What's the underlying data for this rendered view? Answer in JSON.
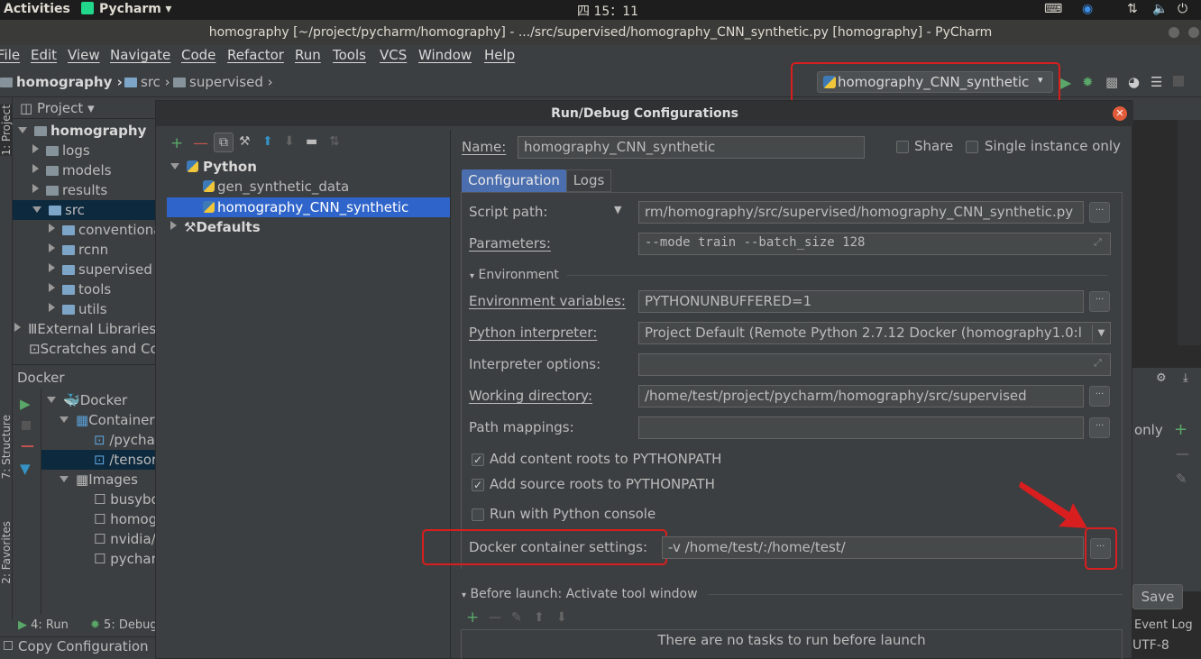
{
  "topbar": {
    "activities": "Activities",
    "app": "Pycharm",
    "clock": "四 15：11"
  },
  "window_title": "homography [~/project/pycharm/homography] - .../src/supervised/homography_CNN_synthetic.py [homography] - PyCharm",
  "menu": [
    "File",
    "Edit",
    "View",
    "Navigate",
    "Code",
    "Refactor",
    "Run",
    "Tools",
    "VCS",
    "Window",
    "Help"
  ],
  "breadcrumb": [
    "homography",
    "src",
    "supervised"
  ],
  "run_config_selector": "homography_CNN_synthetic",
  "project_panel": {
    "title": "Project",
    "items": [
      "homography",
      "logs",
      "models",
      "results",
      "src",
      "conventional",
      "rcnn",
      "supervised",
      "tools",
      "utils",
      "External Libraries",
      "Scratches and Consoles"
    ]
  },
  "docker_panel": {
    "title": "Docker",
    "items": [
      "Docker",
      "Containers",
      "/pycharm",
      "/tensorflow",
      "Images",
      "busybox",
      "homography",
      "nvidia/",
      "pycharm"
    ]
  },
  "side_tabs": {
    "project": "1: Project",
    "structure": "7: Structure",
    "favorites": "2: Favorites"
  },
  "bottom_bar": {
    "run": "4: Run",
    "debug": "5: Debug",
    "status": "Copy Configuration",
    "event_log": "Event Log",
    "encoding": "UTF-8"
  },
  "dialog": {
    "title": "Run/Debug Configurations",
    "tree": {
      "python": "Python",
      "cfg1": "gen_synthetic_data",
      "cfg2": "homography_CNN_synthetic",
      "defaults": "Defaults"
    },
    "name_label": "Name:",
    "name_value": "homography_CNN_synthetic",
    "share": "Share",
    "single_instance": "Single instance only",
    "tabs": [
      "Configuration",
      "Logs"
    ],
    "script_path_label": "Script path:",
    "script_path": "rm/homography/src/supervised/homography_CNN_synthetic.py",
    "parameters_label": "Parameters:",
    "parameters": "--mode train --batch_size 128",
    "environment_label": "Environment",
    "env_vars_label": "Environment variables:",
    "env_vars": "PYTHONUNBUFFERED=1",
    "interpreter_label": "Python interpreter:",
    "interpreter": "Project Default (Remote Python 2.7.12 Docker (homography1.0:l",
    "interp_options_label": "Interpreter options:",
    "interp_options": "",
    "working_dir_label": "Working directory:",
    "working_dir": "/home/test/project/pycharm/homography/src/supervised",
    "path_mappings_label": "Path mappings:",
    "path_mappings": "",
    "add_content_roots": "Add content roots to PYTHONPATH",
    "add_source_roots": "Add source roots to PYTHONPATH",
    "run_with_console": "Run with Python console",
    "docker_settings_label": "Docker container settings:",
    "docker_settings": "-v /home/test/:/home/test/",
    "before_launch": "Before launch: Activate tool window",
    "no_tasks": "There are no tasks to run before launch"
  },
  "right_edge": {
    "only": "only",
    "save": "Save"
  },
  "colors": {
    "accent": "#2f65ca",
    "highlight_red": "#d81e1e",
    "run_green": "#59a869"
  }
}
